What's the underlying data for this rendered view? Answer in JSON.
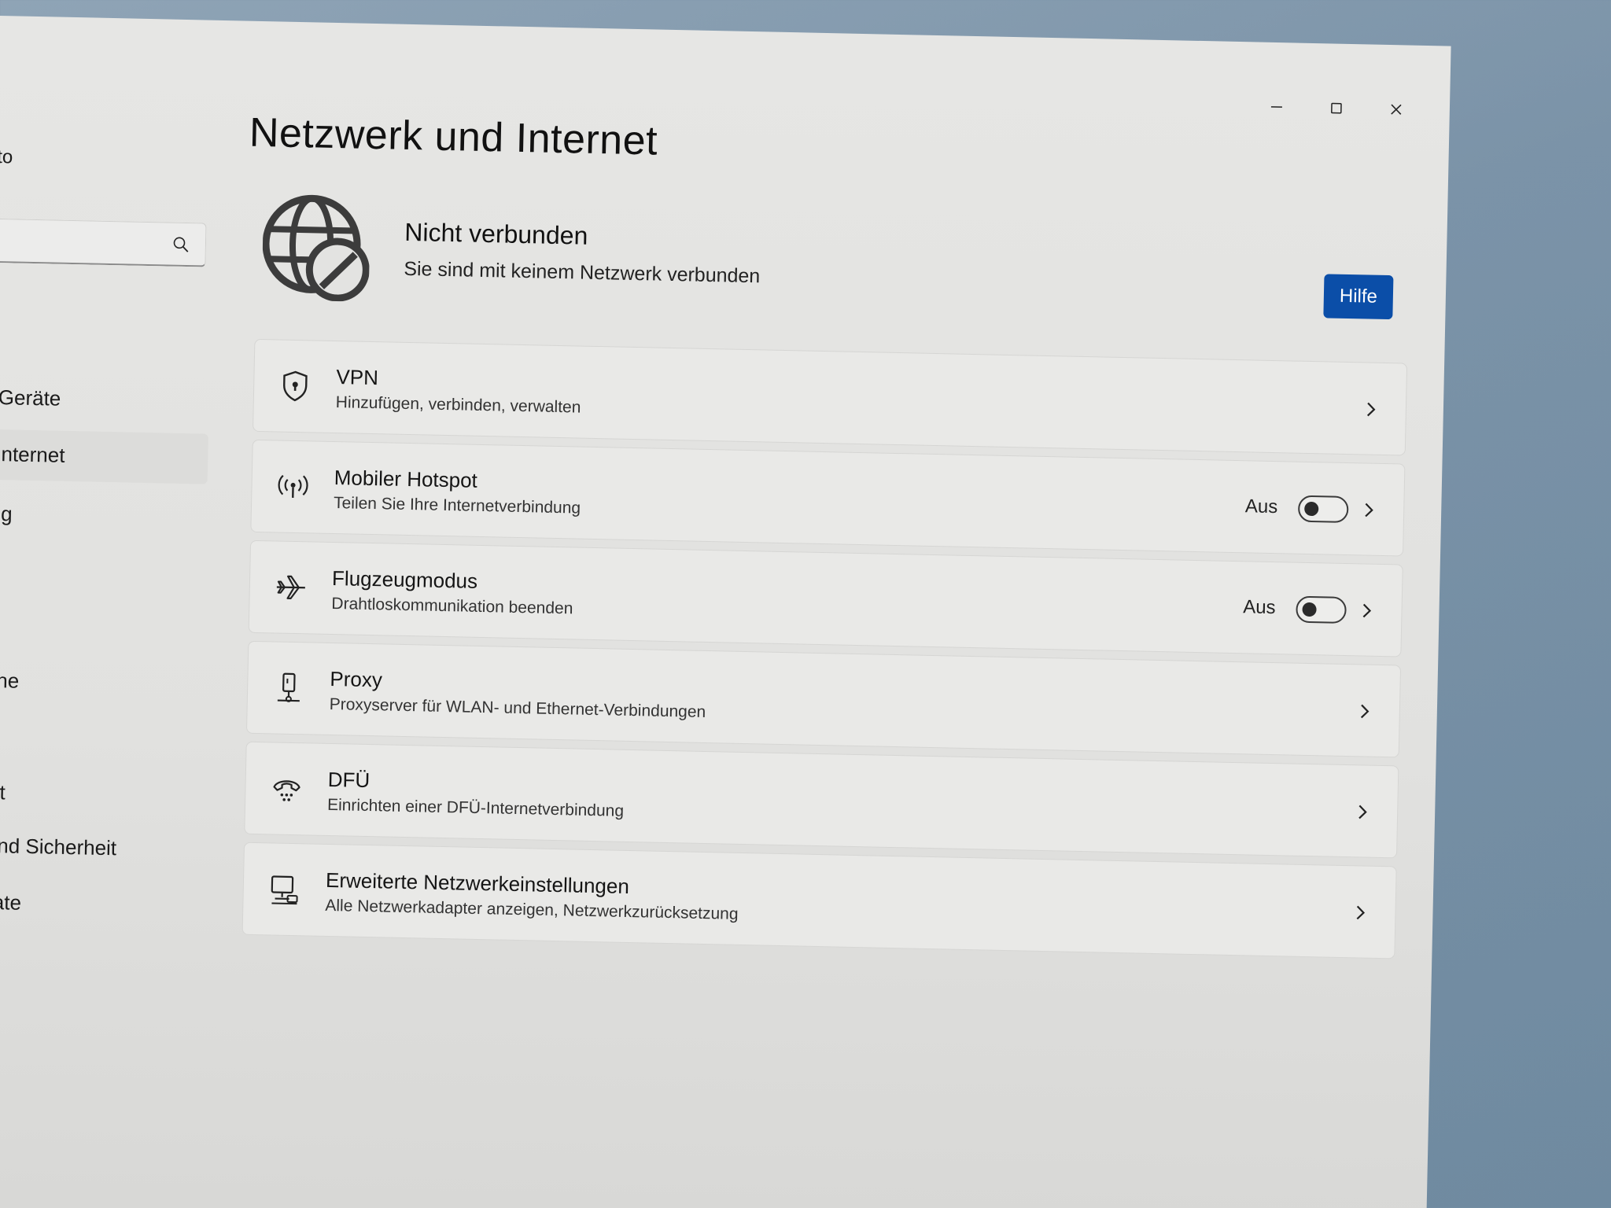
{
  "sidebar": {
    "account_fragment": "to",
    "items": [
      {
        "label": "Geräte"
      },
      {
        "label": "Internet"
      },
      {
        "label": "ng"
      },
      {
        "label": "che"
      },
      {
        "label": "eit"
      },
      {
        "label": "und Sicherheit"
      },
      {
        "label": "date"
      }
    ],
    "search_icon": "search-icon"
  },
  "window_controls": {
    "minimize": "minimize-icon",
    "maximize": "maximize-icon",
    "close": "close-icon"
  },
  "page": {
    "title": "Netzwerk und Internet",
    "status": {
      "title": "Nicht verbunden",
      "subtitle": "Sie sind mit keinem Netzwerk verbunden",
      "icon": "globe-disconnected-icon"
    },
    "help_label": "Hilfe"
  },
  "settings": [
    {
      "title": "VPN",
      "subtitle": "Hinzufügen, verbinden, verwalten",
      "icon": "shield-icon"
    },
    {
      "title": "Mobiler Hotspot",
      "subtitle": "Teilen Sie Ihre Internetverbindung",
      "icon": "hotspot-icon",
      "state": "Aus",
      "toggle_on": false
    },
    {
      "title": "Flugzeugmodus",
      "subtitle": "Drahtloskommunikation beenden",
      "icon": "airplane-icon",
      "state": "Aus",
      "toggle_on": false
    },
    {
      "title": "Proxy",
      "subtitle": "Proxyserver für WLAN- und Ethernet-Verbindungen",
      "icon": "proxy-icon"
    },
    {
      "title": "DFÜ",
      "subtitle": "Einrichten einer DFÜ-Internetverbindung",
      "icon": "dialup-icon"
    },
    {
      "title": "Erweiterte Netzwerkeinstellungen",
      "subtitle": "Alle Netzwerkadapter anzeigen, Netzwerkzurücksetzung",
      "icon": "network-computer-icon"
    }
  ],
  "colors": {
    "accent": "#0b4ea8",
    "background": "#e3e3e1",
    "card": "#e9e9e7"
  }
}
